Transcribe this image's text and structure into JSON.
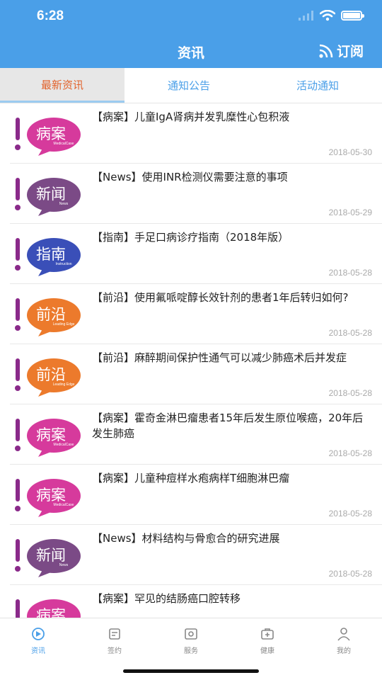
{
  "status_bar": {
    "time": "6:28"
  },
  "header": {
    "title": "资讯",
    "subscribe_label": "订阅"
  },
  "tabs": [
    {
      "label": "最新资讯",
      "active": true
    },
    {
      "label": "通知公告",
      "active": false
    },
    {
      "label": "活动通知",
      "active": false
    }
  ],
  "badge_types": {
    "case": {
      "text": "病案",
      "color": "#d63a9c",
      "sub": "MedicalCase"
    },
    "news": {
      "text": "新闻",
      "color": "#7b4a86",
      "sub": "News"
    },
    "guide": {
      "text": "指南",
      "color": "#3a4fb8",
      "sub": "Instruction"
    },
    "frontier": {
      "text": "前沿",
      "color": "#ec7a2c",
      "sub": "Leading Edge"
    }
  },
  "accent": {
    "exclaim_color": "#8a2a8a",
    "header_bg": "#4a9fe8",
    "active_tab_text": "#e2622b"
  },
  "items": [
    {
      "badge": "case",
      "title": "【病案】儿童IgA肾病并发乳糜性心包积液",
      "date": "2018-05-30"
    },
    {
      "badge": "news",
      "title": "【News】使用INR检测仪需要注意的事项",
      "date": "2018-05-29"
    },
    {
      "badge": "guide",
      "title": "【指南】手足口病诊疗指南（2018年版）",
      "date": "2018-05-28"
    },
    {
      "badge": "frontier",
      "title": "【前沿】使用氟哌啶醇长效针剂的患者1年后转归如何?",
      "date": "2018-05-28"
    },
    {
      "badge": "frontier",
      "title": "【前沿】麻醉期间保护性通气可以减少肺癌术后并发症",
      "date": "2018-05-28"
    },
    {
      "badge": "case",
      "title": "【病案】霍奇金淋巴瘤患者15年后发生原位喉癌，20年后发生肺癌",
      "date": "2018-05-28"
    },
    {
      "badge": "case",
      "title": "【病案】儿童种痘样水疱病样T细胞淋巴瘤",
      "date": "2018-05-28"
    },
    {
      "badge": "news",
      "title": "【News】材料结构与骨愈合的研究进展",
      "date": "2018-05-28"
    },
    {
      "badge": "case",
      "title": "【病案】罕见的结肠癌口腔转移",
      "date": ""
    }
  ],
  "tabbar": [
    {
      "label": "资讯",
      "icon": "news-icon",
      "active": true
    },
    {
      "label": "签约",
      "icon": "sign-icon",
      "active": false
    },
    {
      "label": "服务",
      "icon": "service-icon",
      "active": false
    },
    {
      "label": "健康",
      "icon": "health-icon",
      "active": false
    },
    {
      "label": "我的",
      "icon": "profile-icon",
      "active": false
    }
  ]
}
